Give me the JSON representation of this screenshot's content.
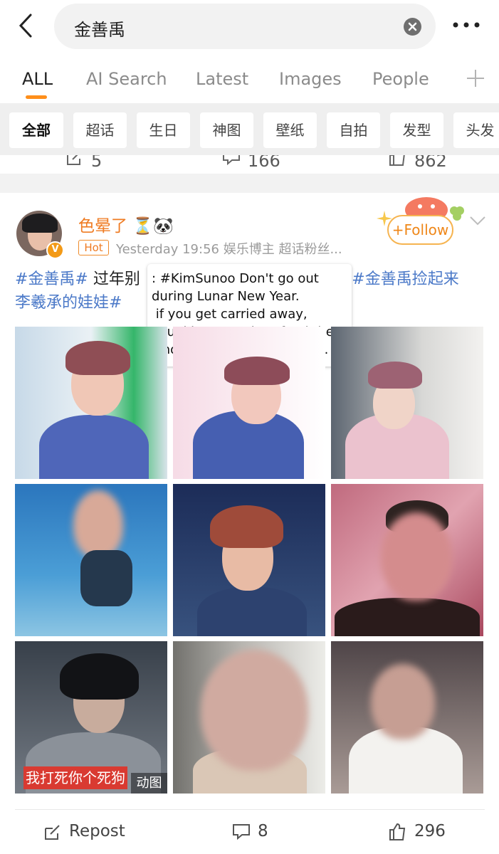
{
  "search": {
    "query": "金善禹"
  },
  "tabs": [
    {
      "label": "ALL"
    },
    {
      "label": "AI Search"
    },
    {
      "label": "Latest"
    },
    {
      "label": "Images"
    },
    {
      "label": "People"
    }
  ],
  "chips": [
    "全部",
    "超话",
    "生日",
    "神图",
    "壁纸",
    "自拍",
    "发型",
    "头发"
  ],
  "previous_post": {
    "reposts": "5",
    "comments": "166",
    "likes": "862"
  },
  "post": {
    "username": "色晕了",
    "username_emoji": "⏳🐼",
    "hot_badge": "Hot",
    "time": "Yesterday 19:56",
    "source": "娱乐博主 超话粉丝...",
    "follow_label": "Follow",
    "text_tag_1": "#金善禹#",
    "text_mid": " 过年别",
    "text_emoji": "💄",
    "text_tag_2": "#金善禹捡起来",
    "text_line_2": "李羲承的娃娃#",
    "translation": ": #KimSunoo Don't go out\nduring Lunar New Year.\n if you get carried away,\nyou'd be enough to feed the\nwhole village for five years.",
    "image_caption": "我打死你个死狗",
    "gif_badge": "动图",
    "actions": {
      "repost_label": "Repost",
      "comment_count": "8",
      "like_count": "296"
    }
  },
  "colors": {
    "accent": "#ff8f1a",
    "hashtag": "#4b79c8",
    "username": "#ef7b22"
  }
}
